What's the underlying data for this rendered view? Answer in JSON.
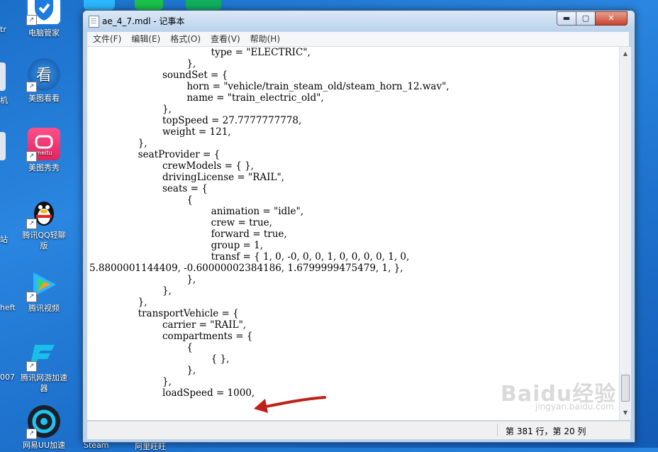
{
  "desktop": {
    "icons": [
      {
        "label": "电脑管家"
      },
      {
        "label": "美图看看"
      },
      {
        "label": "美图秀秀"
      },
      {
        "label": "腾讯QQ轻聊版"
      },
      {
        "label": "腾讯视频"
      },
      {
        "label": "腾讯网游加速器"
      },
      {
        "label": "网易UU加速"
      }
    ],
    "edge_labels": [
      "tr",
      "机",
      "站",
      "heft",
      "007",
      "Steam",
      "阿里旺旺"
    ]
  },
  "window": {
    "title": "ae_4_7.mdl - 记事本",
    "controls": {
      "minimize": "▬",
      "maximize": "▢",
      "close": "✕"
    }
  },
  "menu": [
    "文件(F)",
    "编辑(E)",
    "格式(O)",
    "查看(V)",
    "帮助(H)"
  ],
  "editor": {
    "lines": [
      "\t\t\t\t\ttype = \"ELECTRIC\",",
      "\t\t\t\t},",
      "\t\t\tsoundSet = {",
      "\t\t\t\thorn = \"vehicle/train_steam_old/steam_horn_12.wav\",",
      "\t\t\t\tname = \"train_electric_old\",",
      "\t\t\t},",
      "\t\t\ttopSpeed = 27.7777777778,",
      "\t\t\tweight = 121,",
      "\t\t},",
      "\t\tseatProvider = {",
      "\t\t\tcrewModels = { },",
      "\t\t\tdrivingLicense = \"RAIL\",",
      "\t\t\tseats = {",
      "\t\t\t\t{",
      "\t\t\t\t\tanimation = \"idle\",",
      "\t\t\t\t\tcrew = true,",
      "\t\t\t\t\tforward = true,",
      "\t\t\t\t\tgroup = 1,",
      "\t\t\t\t\ttransf = { 1, 0, -0, 0, 0, 1, 0, 0, 0, 0, 1, 0,",
      "5.8800001144409, -0.60000002384186, 1.6799999475479, 1, },",
      "\t\t\t\t},",
      "\t\t\t},",
      "\t\t},",
      "\t\ttransportVehicle = {",
      "\t\t\tcarrier = \"RAIL\",",
      "\t\t\tcompartments = {",
      "\t\t\t\t{",
      "\t\t\t\t\t{ },",
      "\t\t\t\t},",
      "\t\t\t},",
      "\t\t\tloadSpeed = 1000,"
    ]
  },
  "status": {
    "position": "第 381 行，第 20 列"
  },
  "watermark": {
    "text": "Baidu经验",
    "sub": "jingyan.baidu.com"
  },
  "colors": {
    "desktop": "#1f74cf",
    "arrow": "#c0201a",
    "close_button": "#c7432b"
  }
}
